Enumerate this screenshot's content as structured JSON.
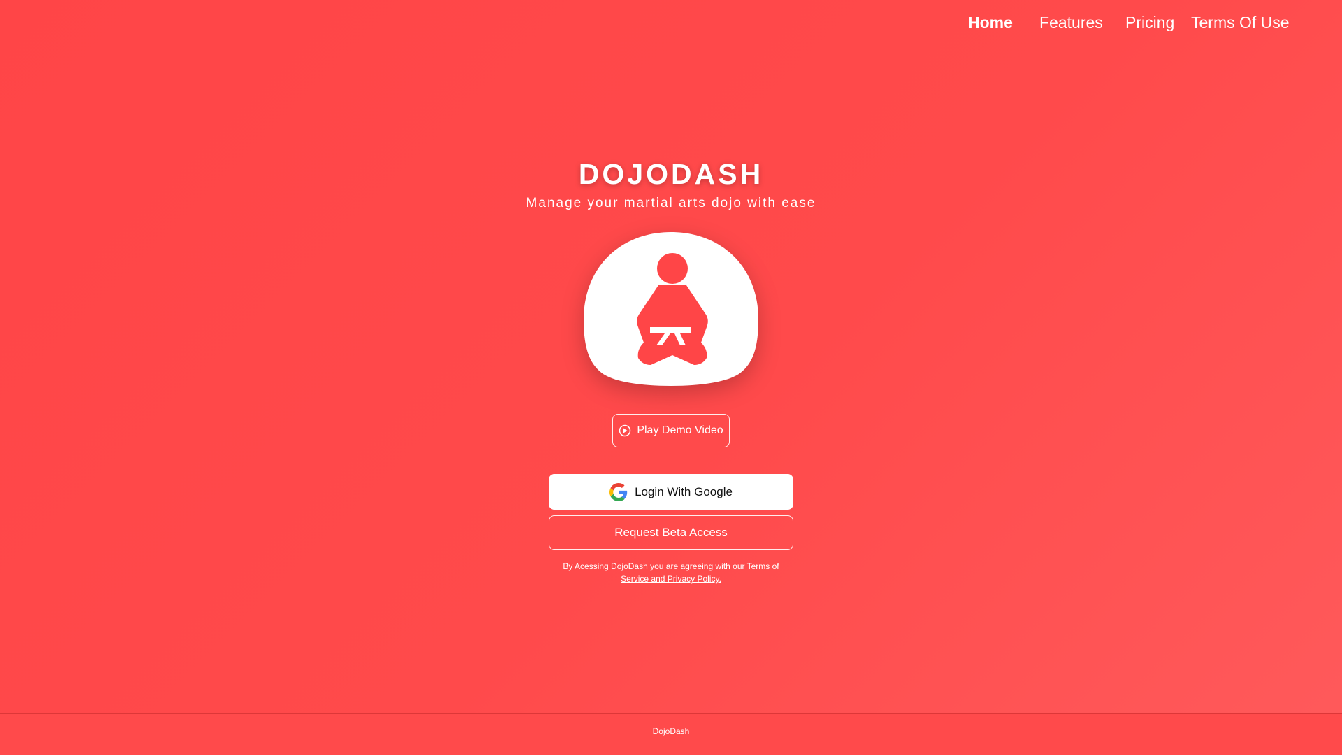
{
  "nav": {
    "items": [
      {
        "label": "Home",
        "active": true
      },
      {
        "label": "Features",
        "active": false
      },
      {
        "label": "Pricing",
        "active": false
      },
      {
        "label": "Terms Of Use",
        "active": false
      }
    ]
  },
  "hero": {
    "title": "DOJODASH",
    "subtitle": "Manage your martial arts dojo with ease",
    "logo_icon": "meditating-martial-artist-icon",
    "demo_button": {
      "label": "Play Demo Video",
      "icon": "play-circle-icon"
    },
    "google_button": {
      "label": "Login With Google",
      "icon": "google-g-icon"
    },
    "beta_button": {
      "label": "Request Beta Access"
    },
    "legal": {
      "prefix": "By Acessing DojoDash you are agreeing with our ",
      "link": "Terms of Service and Privacy Policy."
    }
  },
  "footer": {
    "text": "DojoDash"
  },
  "colors": {
    "background": "#ff4a4b",
    "accent": "#ff4547",
    "button_bg": "#ffffff"
  }
}
